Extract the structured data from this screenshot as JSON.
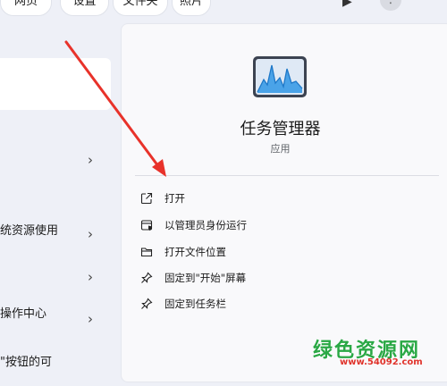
{
  "top_chips": [
    {
      "label": "网页"
    },
    {
      "label": "设置"
    },
    {
      "label": "文件夹"
    },
    {
      "label": "照片"
    }
  ],
  "top_right": {
    "play_glyph": "▶",
    "more_glyph": "⋮"
  },
  "left_list": [
    {
      "label": "",
      "chevron": "›"
    },
    {
      "label": "统资源使用",
      "chevron": "›"
    },
    {
      "label": "",
      "chevron": "›"
    },
    {
      "label": "操作中心",
      "chevron": "›"
    },
    {
      "label": "\"按钮的可",
      "chevron": ""
    }
  ],
  "detail": {
    "app_name": "任务管理器",
    "app_type": "应用",
    "actions": [
      {
        "label": "打开",
        "icon": "open-external-icon"
      },
      {
        "label": "以管理员身份运行",
        "icon": "admin-shield-icon"
      },
      {
        "label": "打开文件位置",
        "icon": "folder-icon"
      },
      {
        "label": "固定到\"开始\"屏幕",
        "icon": "pin-icon"
      },
      {
        "label": "固定到任务栏",
        "icon": "pin-icon"
      }
    ]
  },
  "watermark": {
    "title": "绿色资源网",
    "url": "www.54092.com"
  },
  "colors": {
    "accent_arrow": "#e8322a",
    "watermark_green": "#2aa845",
    "watermark_red": "#e0332b"
  }
}
